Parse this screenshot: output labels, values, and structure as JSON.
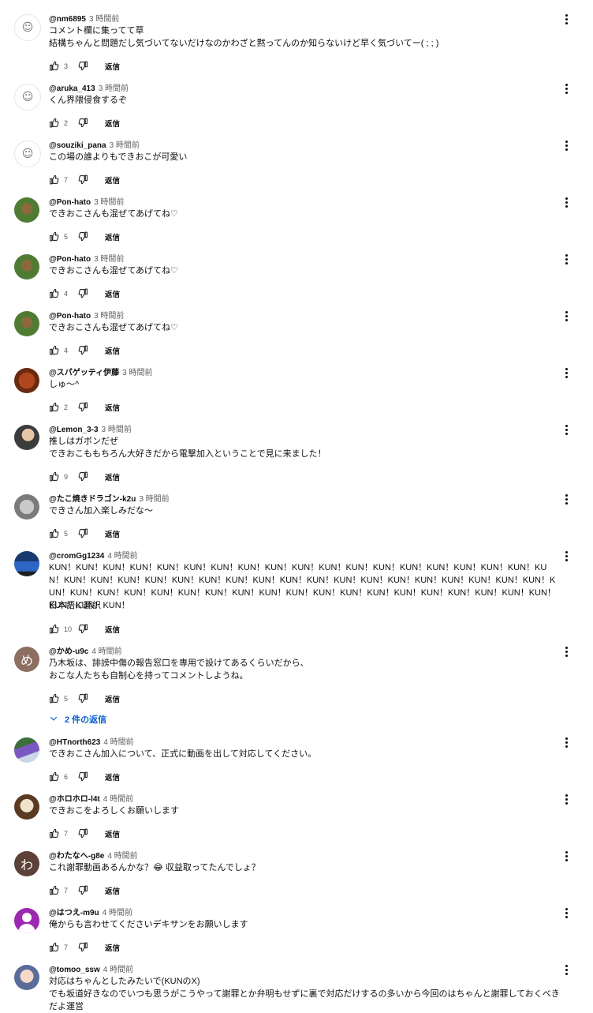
{
  "labels": {
    "reply": "返信",
    "translate": "日本語に翻訳"
  },
  "comments": [
    {
      "author": "@nm6895",
      "time": "3 時間前",
      "text": "コメント欄に集ってて草\n結構ちゃんと問題だし気づいてないだけなのかわざと黙ってんのか知らないけど早く気づいてー( ; ; )",
      "likes": "3",
      "avatar": "sketch"
    },
    {
      "author": "@aruka_413",
      "time": "3 時間前",
      "text": "くん界隈侵食するぞ",
      "likes": "2",
      "avatar": "sketch"
    },
    {
      "author": "@souziki_pana",
      "time": "3 時間前",
      "text": "この場の誰よりもできおこが可愛い",
      "likes": "7",
      "avatar": "sketch"
    },
    {
      "author": "@Pon-hato",
      "time": "3 時間前",
      "text": "できおこさんも混ぜてあげてね♡",
      "likes": "5",
      "avatar": "photo-bird"
    },
    {
      "author": "@Pon-hato",
      "time": "3 時間前",
      "text": "できおこさんも混ぜてあげてね♡",
      "likes": "4",
      "avatar": "photo-bird"
    },
    {
      "author": "@Pon-hato",
      "time": "3 時間前",
      "text": "できおこさんも混ぜてあげてね♡",
      "likes": "4",
      "avatar": "photo-bird"
    },
    {
      "author": "@スパゲッティ伊藤",
      "time": "3 時間前",
      "text": "しゅ〜^",
      "likes": "2",
      "avatar": "photo-food"
    },
    {
      "author": "@Lemon_3-3",
      "time": "3 時間前",
      "text": "推しはガボンだぜ\nできおこももちろん大好きだから電撃加入ということで見に来ました！",
      "likes": "9",
      "avatar": "photo-man"
    },
    {
      "author": "@たこ焼きドラゴン-k2u",
      "time": "3 時間前",
      "text": "できさん加入楽しみだな〜",
      "likes": "5",
      "avatar": "photo-badge"
    },
    {
      "author": "@cromGg1234",
      "time": "4 時間前",
      "text": "KUN！KUN！KUN！KUN！KUN！KUN！KUN！KUN！KUN！KUN！KUN！KUN！KUN！KUN！KUN！KUN！KUN！KUN！KUN！KUN！KUN！KUN！KUN！KUN！KUN！KUN！KUN！KUN！KUN！KUN！KUN！KUN！KUN！KUN！KUN！KUN！KUN！KUN！KUN！KUN！KUN！KUN！KUN！KUN！KUN！KUN！KUN！KUN！KUN！KUN！KUN！KUN！KUN！KUN！KUN！KUN！KUN！KUN！KUN！",
      "likes": "10",
      "avatar": "photo-car",
      "translate": true
    },
    {
      "author": "@かめ-u9c",
      "time": "4 時間前",
      "text": "乃木坂は、誹謗中傷の報告窓口を専用で設けてあるくらいだから、\nおこな人たちも自制心を持ってコメントしようね。",
      "likes": "5",
      "avatar": "letter-brown",
      "letter": "め",
      "replies": "2 件の返信"
    },
    {
      "author": "@HTnorth623",
      "time": "4 時間前",
      "text": "できおこさん加入について、正式に動画を出して対応してください。",
      "likes": "6",
      "avatar": "photo-sky"
    },
    {
      "author": "@ホロホロ-l4t",
      "time": "4 時間前",
      "text": "できおこをよろしくお願いします",
      "likes": "7",
      "avatar": "photo-dog"
    },
    {
      "author": "@わたなへ-g8e",
      "time": "4 時間前",
      "text": "これ謝罪動画あるんかな？😂 収益取ってたんでしょ？",
      "likes": "7",
      "avatar": "letter-dark",
      "letter": "わ"
    },
    {
      "author": "@はつえ-m9u",
      "time": "4 時間前",
      "text": "俺からも言わせてくださいデキサンをお願いします",
      "likes": "7",
      "avatar": "user-purple"
    },
    {
      "author": "@tomoo_ssw",
      "time": "4 時間前",
      "text": "対応はちゃんとしたみたいで(KUNのX)\nでも坂道好きなのでいつも思うがこうやって謝罪とか弁明もせずに裏で対応だけするの多いから今回のはちゃんと謝罪しておくべきだよ運営",
      "likes": "",
      "avatar": "photo-anime"
    }
  ]
}
